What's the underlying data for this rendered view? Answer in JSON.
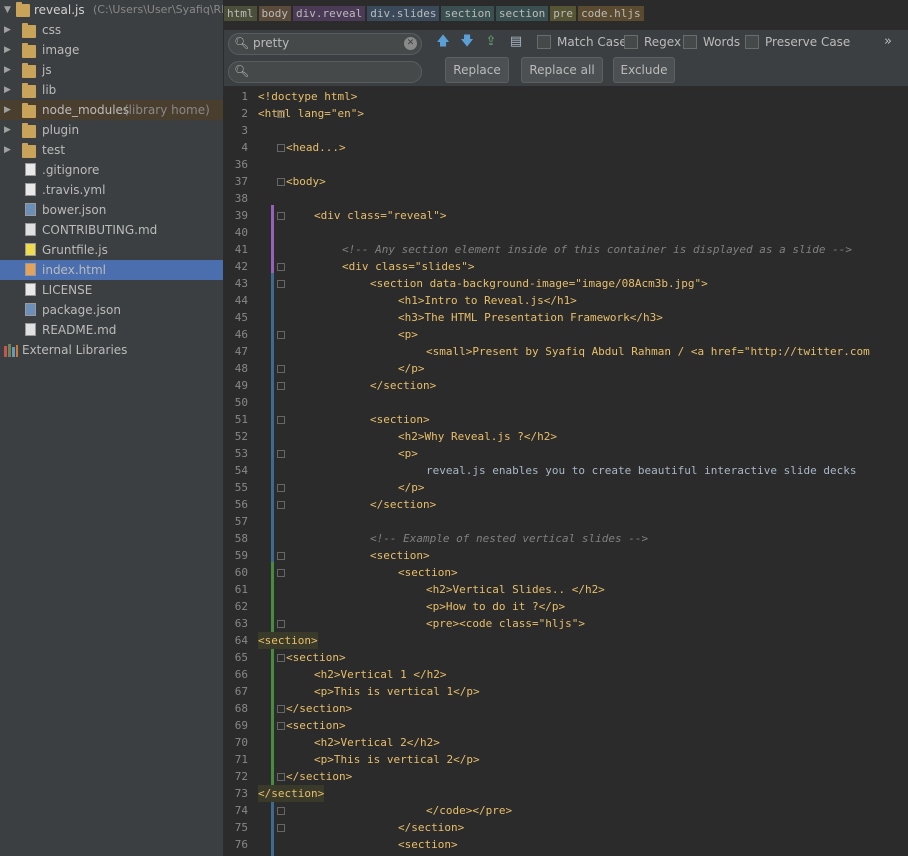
{
  "project": {
    "root_name": "reveal.js",
    "root_path": "(C:\\Users\\User\\Syafiq\\REVEA",
    "items": [
      {
        "label": "css",
        "kind": "folder",
        "note": ""
      },
      {
        "label": "image",
        "kind": "folder",
        "note": ""
      },
      {
        "label": "js",
        "kind": "folder",
        "note": ""
      },
      {
        "label": "lib",
        "kind": "folder",
        "note": ""
      },
      {
        "label": "node_modules",
        "kind": "folder",
        "note": "(library home)"
      },
      {
        "label": "plugin",
        "kind": "folder",
        "note": ""
      },
      {
        "label": "test",
        "kind": "folder",
        "note": ""
      },
      {
        "label": ".gitignore",
        "kind": "txt",
        "note": ""
      },
      {
        "label": ".travis.yml",
        "kind": "txt",
        "note": ""
      },
      {
        "label": "bower.json",
        "kind": "json",
        "note": ""
      },
      {
        "label": "CONTRIBUTING.md",
        "kind": "md",
        "note": ""
      },
      {
        "label": "Gruntfile.js",
        "kind": "js",
        "note": ""
      },
      {
        "label": "index.html",
        "kind": "html",
        "note": ""
      },
      {
        "label": "LICENSE",
        "kind": "txt",
        "note": ""
      },
      {
        "label": "package.json",
        "kind": "json",
        "note": ""
      },
      {
        "label": "README.md",
        "kind": "md",
        "note": ""
      }
    ],
    "external": "External Libraries"
  },
  "breadcrumb": [
    "html",
    "body",
    "div.reveal",
    "div.slides",
    "section",
    "section",
    "pre",
    "code.hljs"
  ],
  "find": {
    "search_value": "pretty",
    "replace_value": "",
    "options": [
      "Match Case",
      "Regex",
      "Words",
      "Preserve Case"
    ],
    "more": "»",
    "buttons": [
      "Replace",
      "Replace all",
      "Exclude"
    ]
  },
  "editor": {
    "line_numbers": [
      "1",
      "2",
      "3",
      "4",
      "36",
      "37",
      "38",
      "39",
      "40",
      "41",
      "42",
      "43",
      "44",
      "45",
      "46",
      "47",
      "48",
      "49",
      "50",
      "51",
      "52",
      "53",
      "54",
      "55",
      "56",
      "57",
      "58",
      "59",
      "60",
      "61",
      "62",
      "63",
      "64",
      "65",
      "66",
      "67",
      "68",
      "69",
      "70",
      "71",
      "72",
      "73",
      "74",
      "75",
      "76"
    ],
    "lines": [
      "<!doctype html>",
      "<html lang=\"en\">",
      "",
      "<head...>",
      "",
      "<body>",
      "",
      "<div class=\"reveal\">",
      "",
      "<!-- Any section element inside of this container is displayed as a slide -->",
      "<div class=\"slides\">",
      "<section data-background-image=\"image/08Acm3b.jpg\">",
      "<h1>Intro to Reveal.js</h1>",
      "<h3>The HTML Presentation Framework</h3>",
      "<p>",
      "<small>Present by Syafiq Abdul Rahman / <a href=\"http://twitter.com",
      "</p>",
      "</section>",
      "",
      "<section>",
      "<h2>Why Reveal.js ?</h2>",
      "<p>",
      "reveal.js enables you to create beautiful interactive slide decks",
      "</p>",
      "</section>",
      "",
      "<!-- Example of nested vertical slides -->",
      "<section>",
      "<section>",
      "<h2>Vertical Slides.. </h2>",
      "<p>How to do it ?</p>",
      "<pre><code class=\"hljs\">",
      "<section>",
      "<section>",
      "<h2>Vertical 1 </h2>",
      "<p>This is vertical 1</p>",
      "</section>",
      "<section>",
      "<h2>Vertical 2</h2>",
      "<p>This is vertical 2</p>",
      "</section>",
      "</section>",
      "</code></pre>",
      "</section>",
      "<section>"
    ]
  }
}
